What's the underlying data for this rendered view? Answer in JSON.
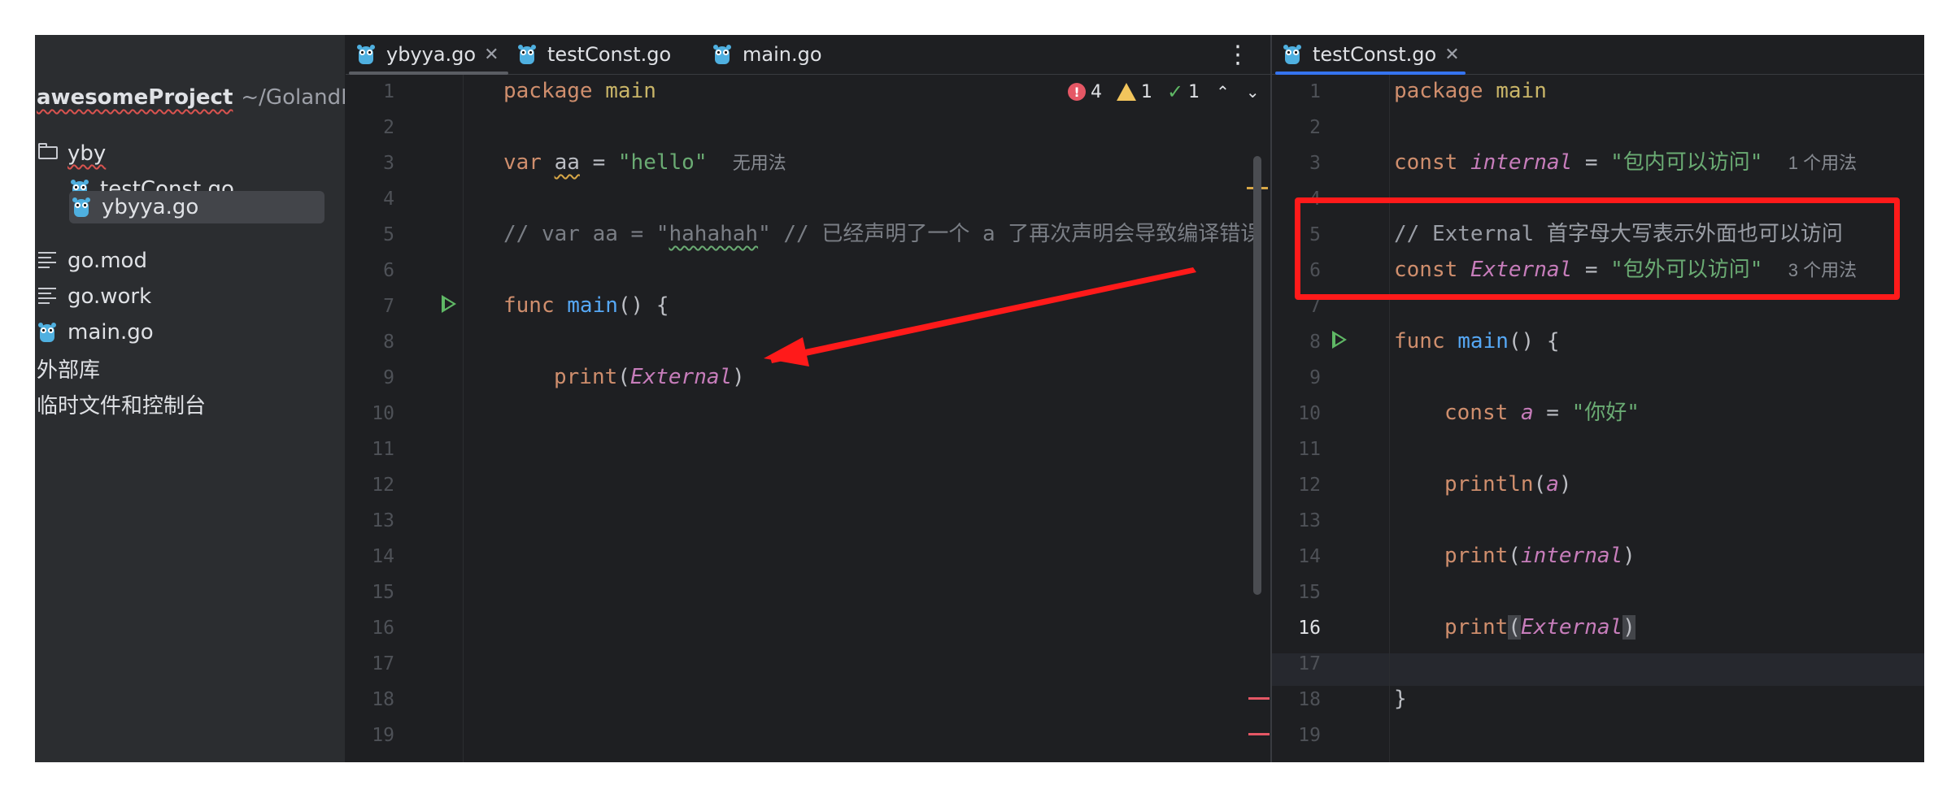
{
  "sidebar": {
    "project_name": "awesomeProject",
    "project_path": "~/GolandPro",
    "items": [
      {
        "label": "yby",
        "icon": "folder-icon"
      },
      {
        "label": "testConst.go",
        "icon": "go-gopher-icon"
      },
      {
        "label": "ybyya.go",
        "icon": "go-gopher-icon",
        "selected": true
      },
      {
        "label": "go.mod",
        "icon": "go-mod-icon"
      },
      {
        "label": "go.work",
        "icon": "go-work-icon"
      },
      {
        "label": "main.go",
        "icon": "go-gopher-icon"
      },
      {
        "label": "外部库"
      },
      {
        "label": "临时文件和控制台"
      }
    ]
  },
  "left_editor": {
    "tabs": [
      {
        "label": "ybyya.go",
        "active": true,
        "closable": true
      },
      {
        "label": "testConst.go"
      },
      {
        "label": "main.go"
      }
    ],
    "inspections": {
      "errors": "4",
      "warnings": "1",
      "weak_warnings": "1"
    },
    "line_numbers": [
      "1",
      "2",
      "3",
      "4",
      "5",
      "6",
      "7",
      "8",
      "9",
      "10",
      "11",
      "12",
      "13",
      "14",
      "15",
      "16",
      "17",
      "18",
      "19"
    ],
    "code": {
      "l1_kw": "package",
      "l1_name": "main",
      "l3_kw": "var",
      "l3_var": "aa",
      "l3_op": " = ",
      "l3_str": "\"hello\"",
      "l3_hint": "无用法",
      "l5_c1": "// var aa = \"",
      "l5_c2": "hahahah",
      "l5_c3": "\" // 已经声明了一个 a 了再次声明会导致编译错误",
      "l7_kw": "func",
      "l7_fn": "main",
      "l7_rest": "() {",
      "l9_fn": "print",
      "l9_open": "(",
      "l9_arg": "External",
      "l9_close": ")"
    }
  },
  "right_editor": {
    "tabs": [
      {
        "label": "testConst.go",
        "active": true,
        "closable": true
      }
    ],
    "line_numbers": [
      "1",
      "2",
      "3",
      "4",
      "5",
      "6",
      "7",
      "8",
      "9",
      "10",
      "11",
      "12",
      "13",
      "14",
      "15",
      "16",
      "17",
      "18",
      "19"
    ],
    "current_line": "16",
    "code": {
      "l1_kw": "package",
      "l1_name": "main",
      "l3_kw": "const",
      "l3_name": "internal",
      "l3_op": " = ",
      "l3_str": "\"包内可以访问\"",
      "l3_hint": "1 个用法",
      "l5_cmt": "// External 首字母大写表示外面也可以访问",
      "l6_kw": "const",
      "l6_name": "External",
      "l6_op": " = ",
      "l6_str": "\"包外可以访问\"",
      "l6_hint": "3 个用法",
      "l8_kw": "func",
      "l8_fn": "main",
      "l8_rest": "() {",
      "l10_kw": "const",
      "l10_name": "a",
      "l10_op": " = ",
      "l10_str": "\"你好\"",
      "l12_fn": "println",
      "l12_open": "(",
      "l12_arg": "a",
      "l12_close": ")",
      "l14_fn": "print",
      "l14_open": "(",
      "l14_arg": "internal",
      "l14_close": ")",
      "l16_fn": "print",
      "l16_open": "(",
      "l16_arg": "External",
      "l16_close": ")",
      "l18_brace": "}"
    }
  },
  "colors": {
    "annotation_red": "#ff1a1a",
    "keyword": "#cf8e6d",
    "function": "#56a8f5",
    "string": "#6aab73",
    "constant": "#c77dbb",
    "comment": "#7a7e85",
    "tab_underline_left": "#5a5d63",
    "tab_underline_right": "#3574f0"
  }
}
